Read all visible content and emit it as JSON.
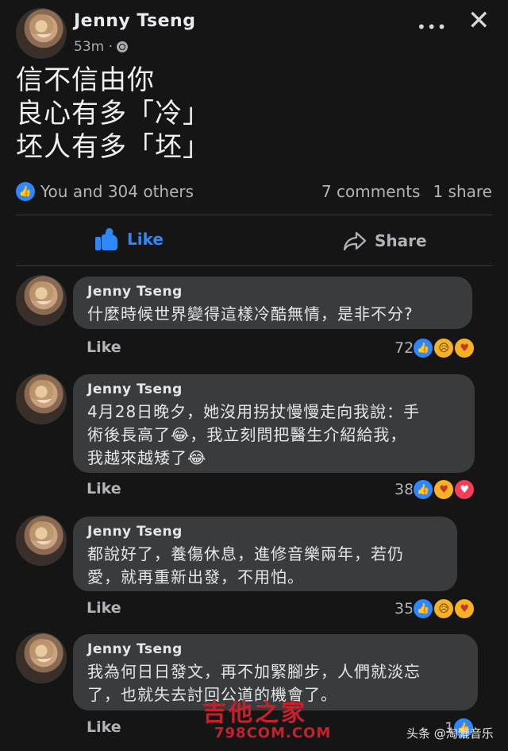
{
  "post": {
    "author": "Jenny  Tseng",
    "time": "53m ·",
    "lines": [
      "信不信由你",
      "良心有多「冷」",
      "坯人有多「坯」"
    ],
    "reactions_text": "You and 304 others",
    "comments_count": "7 comments",
    "shares_count": "1 share"
  },
  "actions": {
    "like_label": "Like",
    "share_label": "Share"
  },
  "comments": [
    {
      "author": "Jenny  Tseng",
      "lines": [
        "什麼時候世界變得這樣冷酷無情，是非不分?"
      ],
      "like_label": "Like",
      "count": "72",
      "reactions": [
        "like-icon",
        "sad-icon",
        "care-icon"
      ]
    },
    {
      "author": "Jenny  Tseng",
      "lines": [
        "4月28日晚夕，她沒用拐扙慢慢走向我說：手",
        "術後長高了😂，我立刻問把醫生介紹給我，",
        "我越來越矮了😂"
      ],
      "like_label": "Like",
      "count": "38",
      "reactions": [
        "like-icon",
        "care-icon",
        "love-icon"
      ]
    },
    {
      "author": "Jenny  Tseng",
      "lines": [
        "都說好了，養傷休息，進修音樂兩年，若仍",
        "愛，就再重新出發，不用怕。"
      ],
      "like_label": "Like",
      "count": "35",
      "reactions": [
        "like-icon",
        "sad-icon",
        "care-icon"
      ]
    },
    {
      "author": "Jenny  Tseng",
      "lines": [
        "我為何日日發文，再不加緊腳步，人們就淡忘",
        "了，也就失去討回公道的機會了。"
      ],
      "like_label": "Like",
      "count": "1",
      "reactions": [
        "like-icon"
      ]
    }
  ],
  "watermark": {
    "brand": "吉他之家",
    "url": "798COM.COM",
    "source": "头条 @淘漉音乐"
  },
  "colors": {
    "background": "#151515",
    "bubble": "#3a3b3c",
    "accent": "#2d88ff"
  }
}
